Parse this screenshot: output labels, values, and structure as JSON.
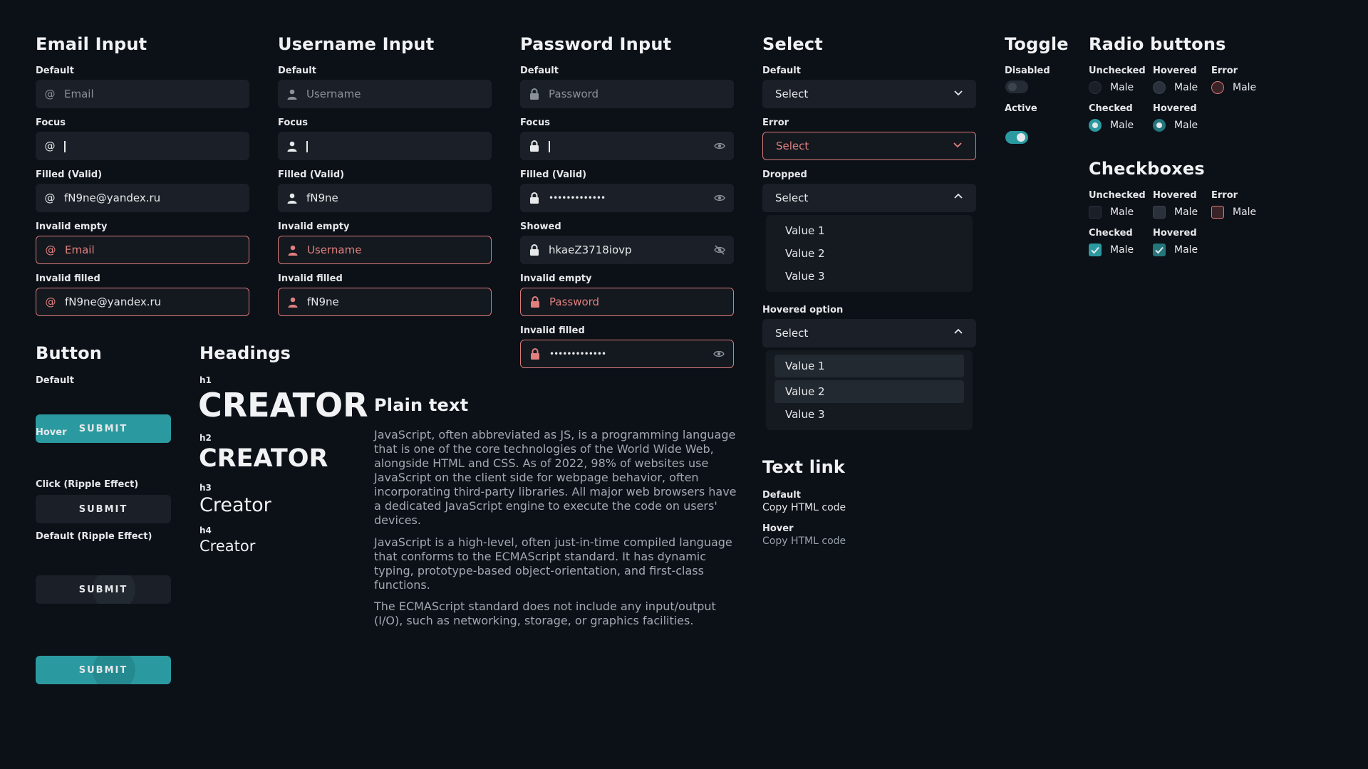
{
  "email": {
    "title": "Email Input",
    "default_label": "Default",
    "default_placeholder": "Email",
    "focus_label": "Focus",
    "filled_label": "Filled (Valid)",
    "filled_value": "fN9ne@yandex.ru",
    "invalid_empty_label": "Invalid empty",
    "invalid_empty_placeholder": "Email",
    "invalid_filled_label": "Invalid filled",
    "invalid_filled_value": "fN9ne@yandex.ru",
    "icon": "at-icon"
  },
  "username": {
    "title": "Username Input",
    "default_label": "Default",
    "default_placeholder": "Username",
    "focus_label": "Focus",
    "filled_label": "Filled (Valid)",
    "filled_value": "fN9ne",
    "invalid_empty_label": "Invalid empty",
    "invalid_empty_placeholder": "Username",
    "invalid_filled_label": "Invalid filled",
    "invalid_filled_value": "fN9ne",
    "icon": "user-icon"
  },
  "password": {
    "title": "Password Input",
    "default_label": "Default",
    "default_placeholder": "Password",
    "focus_label": "Focus",
    "filled_label": "Filled (Valid)",
    "filled_value": "•••••••••••••",
    "showed_label": "Showed",
    "showed_value": "hkaeZ3718iovp",
    "invalid_empty_label": "Invalid empty",
    "invalid_empty_placeholder": "Password",
    "invalid_filled_label": "Invalid filled",
    "invalid_filled_value": "•••••••••••••",
    "icon": "lock-icon"
  },
  "select": {
    "title": "Select",
    "default_label": "Default",
    "error_label": "Error",
    "dropped_label": "Dropped",
    "hovered_label": "Hovered option",
    "value": "Select",
    "options": [
      "Value 1",
      "Value 2",
      "Value 3"
    ]
  },
  "toggle": {
    "title": "Toggle",
    "disabled_label": "Disabled",
    "active_label": "Active"
  },
  "radio": {
    "title": "Radio buttons",
    "unchecked_label": "Unchecked",
    "hovered_label": "Hovered",
    "error_label": "Error",
    "checked_label": "Checked",
    "option": "Male"
  },
  "checkbox": {
    "title": "Checkboxes",
    "unchecked_label": "Unchecked",
    "hovered_label": "Hovered",
    "error_label": "Error",
    "checked_label": "Checked",
    "option": "Male"
  },
  "button": {
    "title": "Button",
    "default_label": "Default",
    "hover_label": "Hover",
    "click_label": "Click (Ripple Effect)",
    "default_ripple_label": "Default (Ripple Effect)",
    "submit": "SUBMIT"
  },
  "headings": {
    "title": "Headings",
    "h1_tag": "h1",
    "h1_text": "CREATOR",
    "h2_tag": "h2",
    "h2_text": "CREATOR",
    "h3_tag": "h3",
    "h3_text": "Creator",
    "h4_tag": "h4",
    "h4_text": "Creator"
  },
  "plain": {
    "title": "Plain text",
    "p1": "JavaScript, often abbreviated as JS, is a programming language that is one of the core technologies of the World Wide Web, alongside HTML and CSS. As of 2022, 98% of websites use JavaScript on the client side for webpage behavior, often incorporating third-party libraries. All major web browsers have a dedicated JavaScript engine to execute the code on users' devices.",
    "p2": "JavaScript is a high-level, often just-in-time compiled language that conforms to the ECMAScript standard. It has dynamic typing, prototype-based object-orientation, and first-class functions.",
    "p3": "The ECMAScript standard does not include any input/output (I/O), such as networking, storage, or graphics facilities."
  },
  "textlink": {
    "title": "Text link",
    "default_label": "Default",
    "hover_label": "Hover",
    "link_text": "Copy HTML code"
  },
  "colors": {
    "background": "#0c1017",
    "field": "#1b2028",
    "accent": "#2b9aa0",
    "error": "#d97a7a"
  }
}
